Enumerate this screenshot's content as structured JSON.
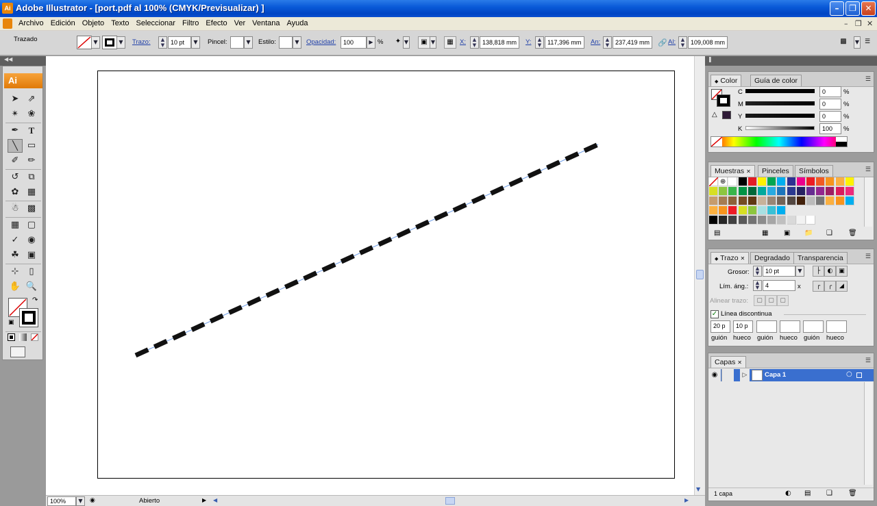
{
  "window": {
    "title": "Adobe Illustrator - [port.pdf al 100% (CMYK/Previsualizar) ]",
    "app_icon_text": "Ai",
    "minimize_icon": "minimize-icon",
    "restore_icon": "restore-icon",
    "close_icon": "close-icon"
  },
  "menu": {
    "items": [
      "Archivo",
      "Edición",
      "Objeto",
      "Texto",
      "Seleccionar",
      "Filtro",
      "Efecto",
      "Ver",
      "Ventana",
      "Ayuda"
    ]
  },
  "control": {
    "selection_label": "Trazado",
    "stroke_link": "Trazo:",
    "stroke_weight": "10 pt",
    "brush_label": "Pincel:",
    "style_label": "Estilo:",
    "opacity_link": "Opacidad:",
    "opacity_value": "100",
    "opacity_unit": "%",
    "x_label": "X:",
    "x_value": "138,818 mm",
    "y_label": "Y:",
    "y_value": "117,396 mm",
    "width_label": "An:",
    "width_value": "237,419 mm",
    "height_label": "Al:",
    "height_value": "109,008 mm"
  },
  "toolbox": {
    "logo": "Ai"
  },
  "canvas": {
    "line_color": "#0d1a2e",
    "dash_color": "#111111",
    "path_highlight": "#6f9ee8"
  },
  "status": {
    "zoom": "100%",
    "state": "Abierto"
  },
  "color_panel": {
    "tabs": [
      "Color",
      "Guía de color"
    ],
    "channels": [
      {
        "label": "C",
        "value": "0",
        "unit": "%"
      },
      {
        "label": "M",
        "value": "0",
        "unit": "%"
      },
      {
        "label": "Y",
        "value": "0",
        "unit": "%"
      },
      {
        "label": "K",
        "value": "100",
        "unit": "%"
      }
    ]
  },
  "swatches_panel": {
    "tabs": [
      "Muestras",
      "Pinceles",
      "Símbolos"
    ]
  },
  "stroke_panel": {
    "tabs": [
      "Trazo",
      "Degradado",
      "Transparencia"
    ],
    "weight_label": "Grosor:",
    "weight_value": "10 pt",
    "miter_label": "Lím. áng.:",
    "miter_value": "4",
    "miter_unit": "x",
    "align_label": "Alinear trazo:",
    "dashed_label": "Línea discontinua",
    "dashed_checked": true,
    "dash_values": [
      "20 p",
      "10 p",
      "",
      "",
      "",
      ""
    ],
    "dash_captions": [
      "guión",
      "hueco",
      "guión",
      "hueco",
      "guión",
      "hueco"
    ]
  },
  "layers_panel": {
    "tabs": [
      "Capas"
    ],
    "layer_name": "Capa 1",
    "footer_count": "1 capa"
  }
}
